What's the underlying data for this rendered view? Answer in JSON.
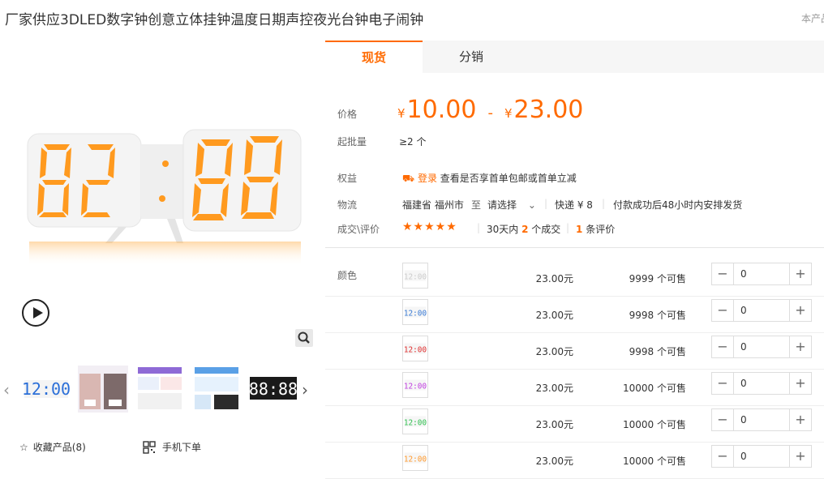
{
  "product": {
    "title": "厂家供应3DLED数字钟创意立体挂钟温度日期声控夜光台钟电子闹钟",
    "topright": "本产品"
  },
  "gallery": {
    "favorite_label": "收藏产品(8)",
    "mobile_label": "手机下单",
    "thumbs": [
      {
        "kind": "blue-digits"
      },
      {
        "kind": "photo-collage"
      },
      {
        "kind": "photo-collage-2"
      },
      {
        "kind": "photo-collage-3"
      },
      {
        "kind": "black-clock"
      }
    ]
  },
  "tabs": [
    {
      "label": "现货"
    },
    {
      "label": "分销"
    }
  ],
  "info": {
    "price_label": "价格",
    "price_currency": "¥",
    "price_low": "10.00",
    "price_sep": "-",
    "price_high": "23.00",
    "moq_label": "起批量",
    "moq_value": "≥2 个",
    "rights_label": "权益",
    "rights_link": "登录",
    "rights_text": "查看是否享首单包邮或首单立减",
    "logistics_label": "物流",
    "ship_from": "福建省 福州市",
    "ship_to_prefix": "至",
    "ship_to": "请选择",
    "express": "快递 ¥ 8",
    "delivery_note": "付款成功后48小时内安排发货",
    "deal_label": "成交\\评价",
    "stars": "★★★★★",
    "deals_prefix": "30天内",
    "deals_count": "2",
    "deals_suffix": "个成交",
    "reviews_count": "1",
    "reviews_suffix": "条评价"
  },
  "variants_label": "颜色",
  "variants": [
    {
      "price": "23.00元",
      "stock": "9999 个可售",
      "qty": "0",
      "color": "#cccccc"
    },
    {
      "price": "23.00元",
      "stock": "9998 个可售",
      "qty": "0",
      "color": "#3a7bd5"
    },
    {
      "price": "23.00元",
      "stock": "9998 个可售",
      "qty": "0",
      "color": "#e03030"
    },
    {
      "price": "23.00元",
      "stock": "10000 个可售",
      "qty": "0",
      "color": "#c040e0"
    },
    {
      "price": "23.00元",
      "stock": "10000 个可售",
      "qty": "0",
      "color": "#30c050"
    },
    {
      "price": "23.00元",
      "stock": "10000 个可售",
      "qty": "0",
      "color": "#ff9a2e"
    }
  ],
  "stepper": {
    "minus": "−",
    "plus": "+"
  },
  "colors": {
    "accent": "#ff6a00",
    "digit": "#ff9a1f"
  }
}
